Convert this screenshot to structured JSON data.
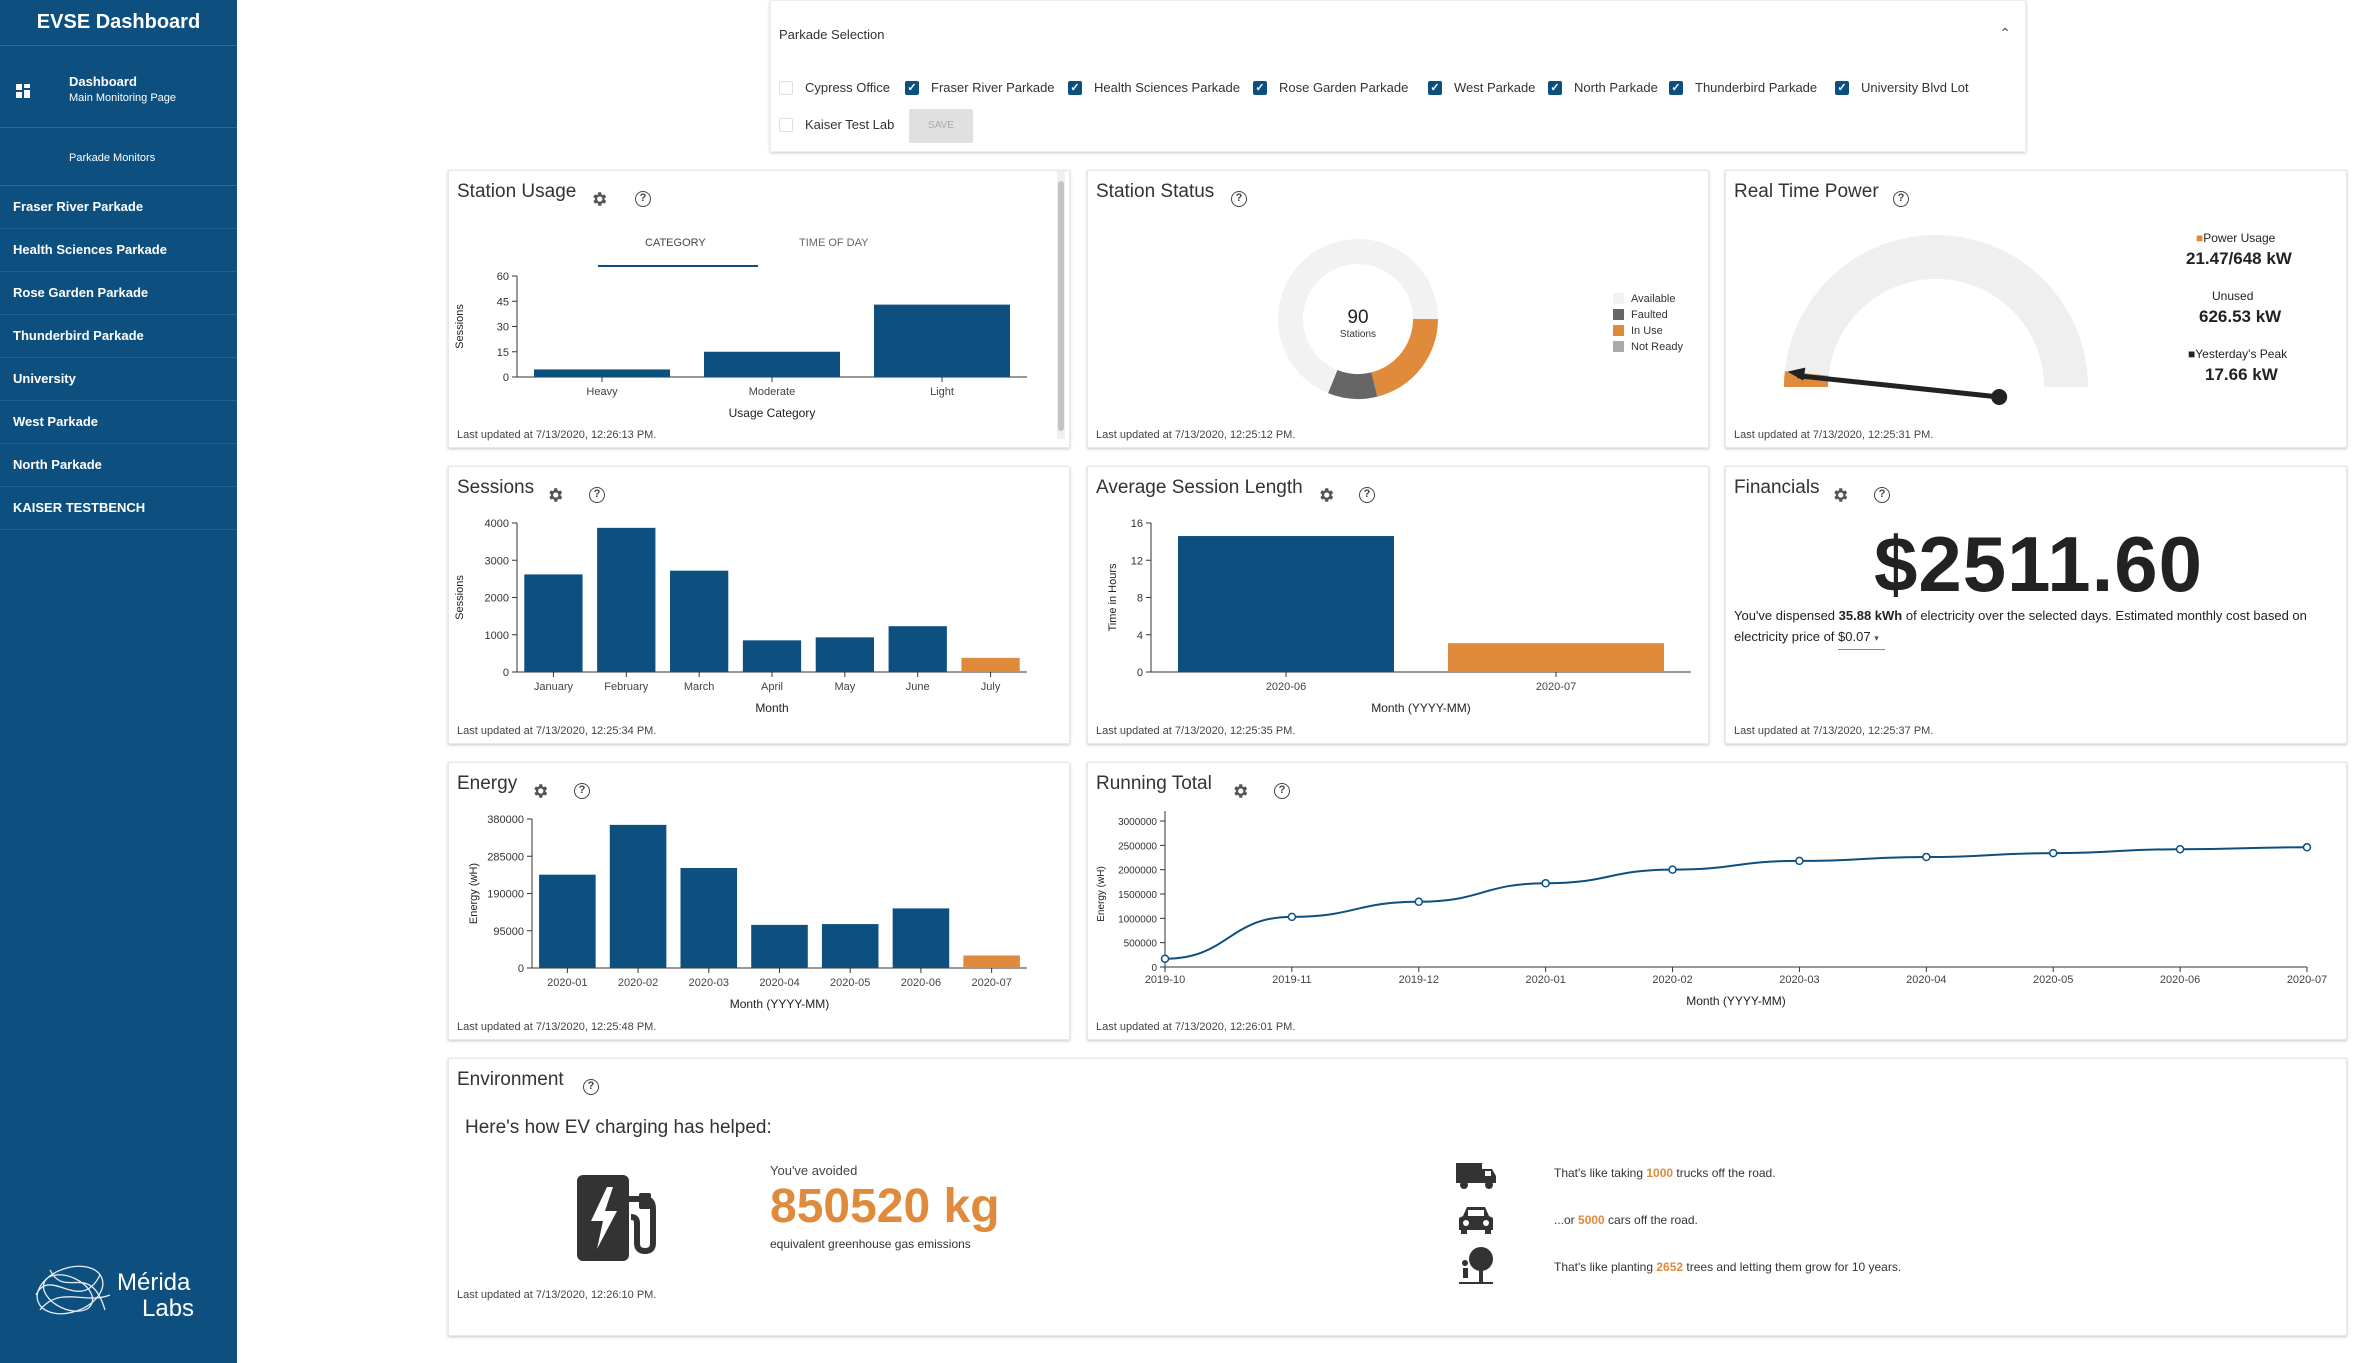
{
  "app": {
    "title": "EVSE Dashboard"
  },
  "sidebar": {
    "dashboard_label": "Dashboard",
    "dashboard_sub": "Main Monitoring Page",
    "monitors_label": "Parkade Monitors",
    "items": [
      "Fraser River Parkade",
      "Health Sciences Parkade",
      "Rose Garden Parkade",
      "Thunderbird Parkade",
      "University",
      "West Parkade",
      "North Parkade",
      "KAISER TESTBENCH"
    ],
    "logo_line1": "Mérida",
    "logo_line2": "Labs"
  },
  "parkade_selection": {
    "header": "Parkade Selection",
    "options": [
      {
        "label": "Cypress Office",
        "checked": false
      },
      {
        "label": "Fraser River Parkade",
        "checked": true
      },
      {
        "label": "Health Sciences Parkade",
        "checked": true
      },
      {
        "label": "Rose Garden Parkade",
        "checked": true
      },
      {
        "label": "West Parkade",
        "checked": true
      },
      {
        "label": "North Parkade",
        "checked": true
      },
      {
        "label": "Thunderbird Parkade",
        "checked": true
      },
      {
        "label": "University Blvd Lot",
        "checked": true
      },
      {
        "label": "Kaiser Test Lab",
        "checked": false
      }
    ],
    "save_label": "SAVE"
  },
  "colors": {
    "primary": "#0d5080",
    "accent": "#e08a3c",
    "faulted": "#666666",
    "not_ready": "#aaaaaa",
    "available": "#f2f2f2"
  },
  "station_usage": {
    "title": "Station Usage",
    "tabs": [
      "CATEGORY",
      "TIME OF DAY"
    ],
    "updated": "Last updated at 7/13/2020, 12:26:13 PM."
  },
  "station_status": {
    "title": "Station Status",
    "center_value": "90",
    "center_label": "Stations",
    "legend": [
      "Available",
      "Faulted",
      "In Use",
      "Not Ready"
    ],
    "updated": "Last updated at 7/13/2020, 12:25:12 PM."
  },
  "real_time_power": {
    "title": "Real Time Power",
    "usage_label": "Power Usage",
    "usage_value": "21.47/648 kW",
    "unused_label": "Unused",
    "unused_value": "626.53 kW",
    "peak_label": "Yesterday's Peak",
    "peak_value": "17.66 kW",
    "updated": "Last updated at 7/13/2020, 12:25:31 PM."
  },
  "sessions": {
    "title": "Sessions",
    "updated": "Last updated at 7/13/2020, 12:25:34 PM."
  },
  "avg_session": {
    "title": "Average Session Length",
    "updated": "Last updated at 7/13/2020, 12:25:35 PM."
  },
  "financials": {
    "title": "Financials",
    "amount": "$2511.60",
    "text_pre": "You've dispensed ",
    "kwh": "35.88 kWh",
    "text_post": " of electricity over the selected days. Estimated monthly cost based on electricity price of",
    "price": "$0.07",
    "updated": "Last updated at 7/13/2020, 12:25:37 PM."
  },
  "energy": {
    "title": "Energy",
    "updated": "Last updated at 7/13/2020, 12:25:48 PM."
  },
  "running_total": {
    "title": "Running Total",
    "updated": "Last updated at 7/13/2020, 12:26:01 PM."
  },
  "environment": {
    "title": "Environment",
    "heading": "Here's how EV charging has helped:",
    "avoided_label": "You've avoided",
    "avoided_value": "850520 kg",
    "avoided_sub": "equivalent greenhouse gas emissions",
    "trucks_pre": "That's like taking ",
    "trucks": "1000",
    "trucks_post": " trucks off the road.",
    "cars_pre": "...or ",
    "cars": "5000",
    "cars_post": " cars off the road.",
    "trees_pre": "That's like planting ",
    "trees": "2652",
    "trees_post": " trees and letting them grow for 10 years.",
    "updated": "Last updated at 7/13/2020, 12:26:10 PM."
  },
  "chart_data": [
    {
      "id": "station_usage",
      "type": "bar",
      "categories": [
        "Heavy",
        "Moderate",
        "Light"
      ],
      "values": [
        4.5,
        15,
        43
      ],
      "xlabel": "Usage Category",
      "ylabel": "Sessions",
      "ylim": [
        0,
        60
      ],
      "yticks": [
        0,
        15,
        30,
        45,
        60
      ]
    },
    {
      "id": "station_status",
      "type": "pie",
      "labels": [
        "Available",
        "Faulted",
        "In Use",
        "Not Ready"
      ],
      "values": [
        62,
        9,
        19,
        0
      ]
    },
    {
      "id": "real_time_power",
      "type": "gauge",
      "value": 21.47,
      "max": 648
    },
    {
      "id": "sessions",
      "type": "bar",
      "categories": [
        "January",
        "February",
        "March",
        "April",
        "May",
        "June",
        "July"
      ],
      "values": [
        2620,
        3870,
        2720,
        850,
        930,
        1230,
        380
      ],
      "xlabel": "Month",
      "ylabel": "Sessions",
      "ylim": [
        0,
        4000
      ],
      "yticks": [
        0,
        1000,
        2000,
        3000,
        4000
      ],
      "highlight_last": true
    },
    {
      "id": "avg_session",
      "type": "bar",
      "categories": [
        "2020-06",
        "2020-07"
      ],
      "values": [
        14.6,
        3.1
      ],
      "xlabel": "Month (YYYY-MM)",
      "ylabel": "Time in Hours",
      "ylim": [
        0,
        16
      ],
      "yticks": [
        0,
        4,
        8,
        12,
        16
      ],
      "highlight_last": true
    },
    {
      "id": "energy",
      "type": "bar",
      "categories": [
        "2020-01",
        "2020-02",
        "2020-03",
        "2020-04",
        "2020-05",
        "2020-06",
        "2020-07"
      ],
      "values": [
        238000,
        365000,
        255000,
        110000,
        112000,
        152000,
        32000
      ],
      "xlabel": "Month (YYYY-MM)",
      "ylabel": "Energy (wH)",
      "ylim": [
        0,
        380000
      ],
      "yticks": [
        0,
        95000,
        190000,
        285000,
        380000
      ],
      "highlight_last": true
    },
    {
      "id": "running_total",
      "type": "line",
      "categories": [
        "2019-10",
        "2019-11",
        "2019-12",
        "2020-01",
        "2020-02",
        "2020-03",
        "2020-04",
        "2020-05",
        "2020-06",
        "2020-07"
      ],
      "values": [
        170000,
        1030000,
        1340000,
        1720000,
        2000000,
        2180000,
        2260000,
        2340000,
        2420000,
        2460000
      ],
      "xlabel": "Month (YYYY-MM)",
      "ylabel": "Energy (wH)",
      "ylim": [
        0,
        3000000
      ],
      "yticks": [
        0,
        500000,
        1000000,
        1500000,
        2000000,
        2500000,
        3000000
      ]
    }
  ]
}
